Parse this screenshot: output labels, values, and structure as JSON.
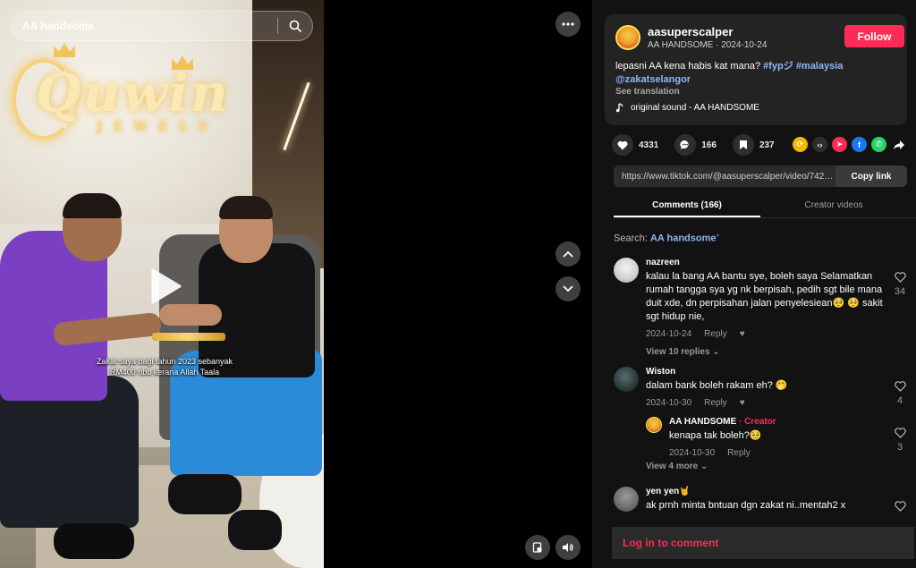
{
  "video": {
    "search_query": "AA handsome",
    "caption": "Zakat saya bagi tahun 2023 sebanyak RM400 ribu kerana Allah Taala",
    "logo_text": "Quwin",
    "logo_sub": "JEWELS"
  },
  "post": {
    "username": "aasuperscalper",
    "display_name": "AA HANDSOME",
    "date": "2024-10-24",
    "follow_label": "Follow",
    "description_text": "lepasni AA kena habis kat mana? ",
    "hashtags": [
      "#fypジ",
      "#malaysia"
    ],
    "mention": "@zakatselangor",
    "see_translation": "See translation",
    "sound": "original sound - AA HANDSOME"
  },
  "stats": {
    "likes": "4331",
    "comments": "166",
    "saves": "237"
  },
  "share": {
    "url": "https://www.tiktok.com/@aasuperscalper/video/7429...",
    "copy_label": "Copy link"
  },
  "tabs": {
    "comments": "Comments (166)",
    "creator_videos": "Creator videos"
  },
  "comment_search": {
    "prefix": "Search: ",
    "term": "AA handsome"
  },
  "comments": [
    {
      "user": "nazreen",
      "text": "kalau la bang AA bantu sye, boleh saya Selamatkan rumah tangga sya yg nk berpisah, pedih sgt bile mana duit xde, dn perpisahan jalan penyelesiean🥺 🥺 sakit sgt hidup nie,",
      "date": "2024-10-24",
      "reply": "Reply",
      "likes": "34",
      "view_replies": "View 10 replies ⌄"
    },
    {
      "user": "Wiston",
      "text": "dalam bank boleh rakam eh? 🤭",
      "date": "2024-10-30",
      "reply": "Reply",
      "likes": "4",
      "sub": {
        "user": "AA HANDSOME",
        "creator": " · Creator",
        "text": "kenapa tak boleh?🥺",
        "date": "2024-10-30",
        "reply": "Reply",
        "likes": "3"
      },
      "view_more": "View 4 more ⌄"
    },
    {
      "user": "yen yen🤘",
      "text": "ak prnh minta bntuan dgn zakat ni..mentah2 x",
      "likes": ""
    }
  ],
  "login_label": "Log in to comment",
  "colors": {
    "accent": "#fe2c55",
    "link": "#8fb7f5",
    "panel_bg": "#121212"
  }
}
